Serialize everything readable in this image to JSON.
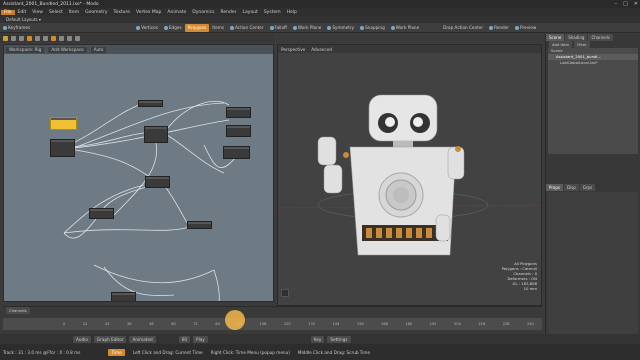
{
  "window": {
    "title": "Assistant_2001_Bundled_2011.lxo* - Modo"
  },
  "menu": [
    "File",
    "Edit",
    "View",
    "Select",
    "Item",
    "Geometry",
    "Texture",
    "Vertex Map",
    "Animate",
    "Dynamics",
    "Render",
    "Layout",
    "System",
    "Help"
  ],
  "layout_tabs": [
    "Modo",
    "Model",
    "Animate",
    "Render",
    "VR"
  ],
  "layout_label": "Default Layouts ▾",
  "toolbar": {
    "items": [
      "Keyframes",
      "Vertices",
      "Edges",
      "Polygons",
      "Items",
      "Action Center",
      "Falloff",
      "Work Plane",
      "Symmetry",
      "Snapping",
      "Work Plane",
      "Drop Action Center",
      "Render",
      "Preview"
    ]
  },
  "schematic": {
    "tab": "Workspace: Rig",
    "field2": "Add Workspace",
    "field3": "Auto"
  },
  "viewport": {
    "tabs": [
      "Perspective",
      "Advanced"
    ],
    "info": [
      "All Polygons",
      "Polygons : Catmull",
      "Channels : 0",
      "Deformers : ON",
      "GL : 163,898",
      "10 mm"
    ]
  },
  "right_panel": {
    "tabs": [
      "Scene",
      "Shading",
      "Channels"
    ],
    "tools": [
      "Add Item",
      "Filter"
    ],
    "items": [
      "Scene",
      "Assistant_2001_bundl...",
      "LabGlobalLocal.lxo*"
    ],
    "lower_tabs": [
      "Props",
      "Disp",
      "Grps"
    ],
    "search": "Search"
  },
  "timeline": {
    "label": "Channels",
    "ticks": [
      "0",
      "12",
      "24",
      "36",
      "48",
      "60",
      "72",
      "84",
      "96",
      "108",
      "120",
      "132",
      "144",
      "156",
      "168",
      "180",
      "192",
      "204",
      "216",
      "228",
      "240"
    ],
    "current_frame": "60"
  },
  "bottombar": {
    "items": [
      "Audio",
      "Graph Editor",
      "Animated",
      "Play",
      "Key",
      "Settings"
    ],
    "frame": "60"
  },
  "status": {
    "left": "Track : 31 : 3.0 ms @Ffor : 0 : 0.8 ms",
    "time": "Time",
    "hint1": "Left Click and Drag: Current Time",
    "hint2": "Right Click: Time Menu (popup menu)",
    "hint3": "Middle Click and Drag: Scrub Time"
  },
  "colors": {
    "accent": "#d48a2e",
    "schematic_bg": "#6e7b85",
    "viewport_bg": "#424242"
  }
}
